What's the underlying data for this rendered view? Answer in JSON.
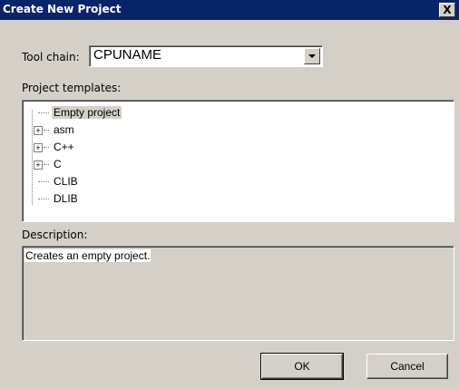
{
  "window": {
    "title": "Create New Project",
    "close_glyph": "X"
  },
  "toolchain": {
    "label": "Tool chain:",
    "value": "CPUNAME"
  },
  "templates": {
    "label": "Project templates:",
    "items": [
      {
        "label": "Empty project",
        "expandable": false,
        "selected": true
      },
      {
        "label": "asm",
        "expandable": true,
        "selected": false
      },
      {
        "label": "C++",
        "expandable": true,
        "selected": false
      },
      {
        "label": "C",
        "expandable": true,
        "selected": false
      },
      {
        "label": "CLIB",
        "expandable": false,
        "selected": false
      },
      {
        "label": "DLIB",
        "expandable": false,
        "selected": false
      }
    ]
  },
  "description": {
    "label": "Description:",
    "text": "Creates an empty project."
  },
  "buttons": {
    "ok": "OK",
    "cancel": "Cancel"
  },
  "colors": {
    "titlebar": "#0a246a",
    "dialog_bg": "#d4d0c8"
  }
}
